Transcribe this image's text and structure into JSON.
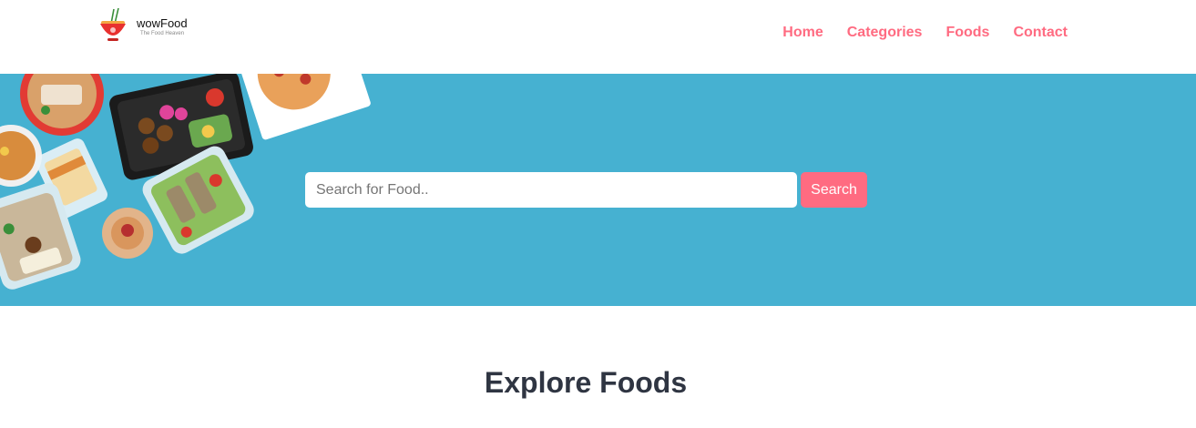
{
  "brand": {
    "name": "wowFood",
    "tagline": "The Food Heaven",
    "logo_icon": "noodle-bowl-icon"
  },
  "nav": {
    "items": [
      {
        "label": "Home"
      },
      {
        "label": "Categories"
      },
      {
        "label": "Foods"
      },
      {
        "label": "Contact"
      }
    ]
  },
  "hero": {
    "background_color": "#46b1d1",
    "image": "food-containers-image",
    "search": {
      "placeholder": "Search for Food..",
      "value": "",
      "button_label": "Search"
    }
  },
  "explore": {
    "title": "Explore Foods"
  },
  "colors": {
    "accent": "#ff6b81",
    "heading": "#2f3542"
  }
}
